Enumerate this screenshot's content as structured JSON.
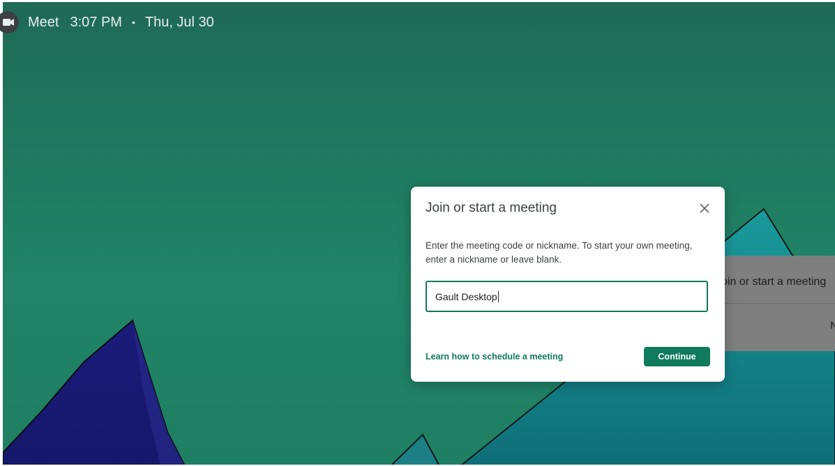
{
  "topbar": {
    "app_name": "Meet",
    "time": "3:07 PM",
    "separator": "•",
    "date": "Thu, Jul 30",
    "logo_icon": "google-meet-icon"
  },
  "dialog": {
    "title": "Join or start a meeting",
    "description": "Enter the meeting code or nickname. To start your own meeting, enter a nickname or leave blank.",
    "input_value": "Gault Desktop",
    "learn_link": "Learn how to schedule a meeting",
    "continue_label": "Continue",
    "close_icon": "close-icon",
    "accent_color": "#0f7a5c"
  },
  "background_card": {
    "title": "oin or start a meeting",
    "button_partial": "N"
  }
}
